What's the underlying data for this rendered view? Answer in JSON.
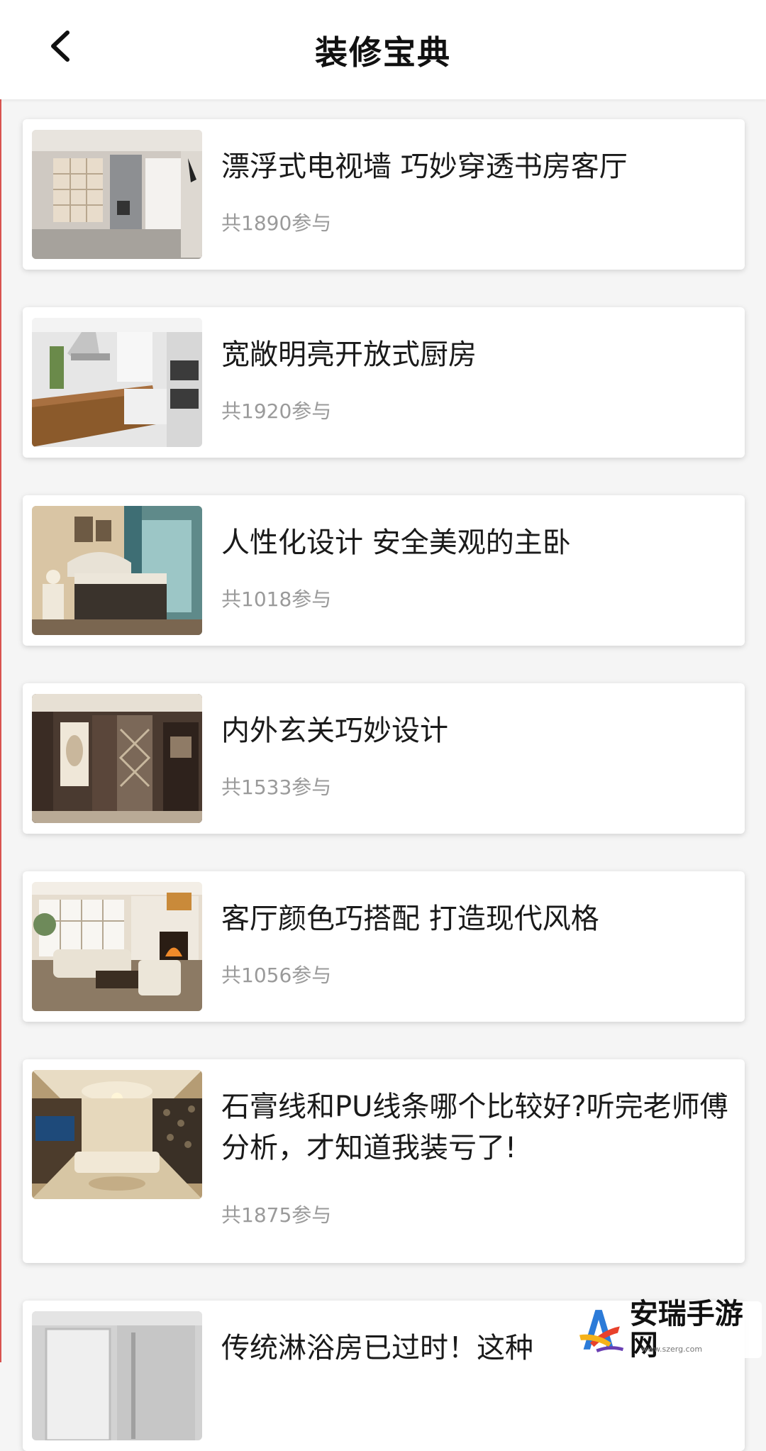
{
  "header": {
    "title": "装修宝典",
    "back_icon": "chevron-left-icon"
  },
  "articles": [
    {
      "title": "漂浮式电视墙 巧妙穿透书房客厅",
      "participants": "共1890参与",
      "image": "study-living-room-photo"
    },
    {
      "title": "宽敞明亮开放式厨房",
      "participants": "共1920参与",
      "image": "open-kitchen-photo"
    },
    {
      "title": "人性化设计 安全美观的主卧",
      "participants": "共1018参与",
      "image": "master-bedroom-photo"
    },
    {
      "title": "内外玄关巧妙设计",
      "participants": "共1533参与",
      "image": "entryway-photo"
    },
    {
      "title": "客厅颜色巧搭配 打造现代风格",
      "participants": "共1056参与",
      "image": "living-room-fireplace-photo"
    },
    {
      "title": "石膏线和PU线条哪个比较好?听完老师傅分析，才知道我装亏了!",
      "participants": "共1875参与",
      "image": "ornate-living-room-photo"
    },
    {
      "title": "传统淋浴房已过时！这种",
      "participants": "",
      "image": "shower-room-photo"
    }
  ],
  "watermark": {
    "text": "安瑞手游网",
    "url": "www.szerg.com"
  },
  "colors": {
    "background": "#f5f5f5",
    "card": "#ffffff",
    "meta_text": "#9a9a9a",
    "title_text": "#1a1a1a"
  }
}
